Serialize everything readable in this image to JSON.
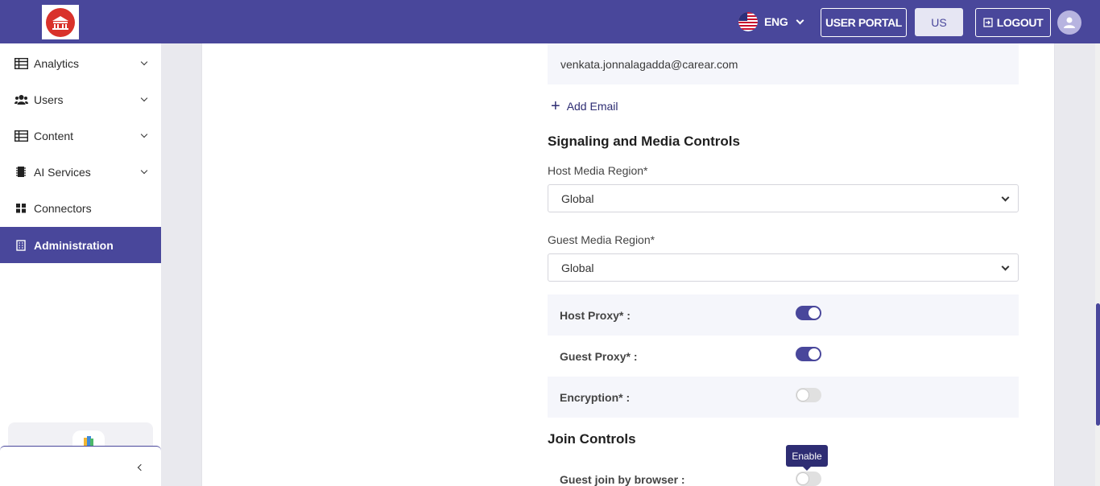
{
  "header": {
    "language": "ENG",
    "user_portal_label": "USER PORTAL",
    "region_label": "US",
    "logout_label": "LOGOUT",
    "colors": {
      "brand": "#49479b",
      "logo_red": "#d9322b"
    }
  },
  "sidebar": {
    "items": [
      {
        "label": "Analytics",
        "icon": "table-icon",
        "expandable": true
      },
      {
        "label": "Users",
        "icon": "users-icon",
        "expandable": true
      },
      {
        "label": "Content",
        "icon": "table-icon",
        "expandable": true
      },
      {
        "label": "AI Services",
        "icon": "chip-icon",
        "expandable": true
      },
      {
        "label": "Connectors",
        "icon": "grid-icon",
        "expandable": false
      },
      {
        "label": "Administration",
        "icon": "building-icon",
        "expandable": false,
        "active": true
      }
    ]
  },
  "main": {
    "email_value": "venkata.jonnalagadda@carear.com",
    "add_email_label": "Add Email",
    "signaling_title": "Signaling and Media Controls",
    "host_media_region_label": "Host Media Region*",
    "host_media_region_value": "Global",
    "guest_media_region_label": "Guest Media Region*",
    "guest_media_region_value": "Global",
    "host_proxy_label": "Host Proxy* :",
    "host_proxy_on": true,
    "guest_proxy_label": "Guest Proxy* :",
    "guest_proxy_on": true,
    "encryption_label": "Encryption* :",
    "encryption_on": false,
    "join_controls_title": "Join Controls",
    "guest_join_label": "Guest join by browser :",
    "guest_join_on": false,
    "tooltip_text": "Enable"
  }
}
